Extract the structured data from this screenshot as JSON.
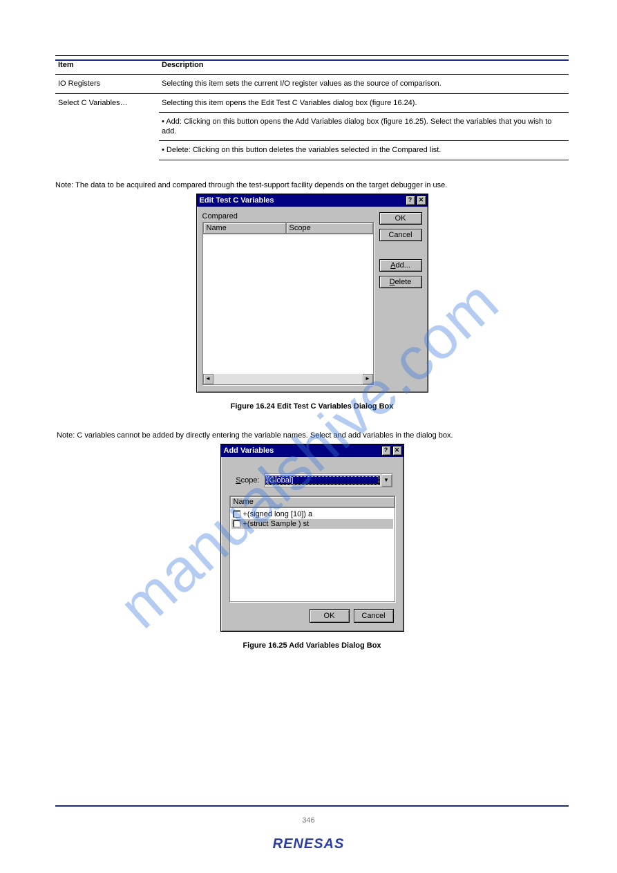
{
  "watermark": "manualshive.com",
  "brand": "RENESAS",
  "page_number": "346",
  "table": {
    "header_left": "Item",
    "header_right": "Description",
    "rows": [
      {
        "item": "IO Registers",
        "desc": "Selecting this item sets the current I/O register values as the source of comparison."
      },
      {
        "item": "Select C Variables…",
        "desc_main": "Selecting this item opens the Edit Test C Variables dialog box (figure 16.24).",
        "sub": [
          "• Add: Clicking on this button opens the Add Variables dialog box (figure 16.25). Select the variables that you wish to add.",
          "• Delete: Clicking on this button deletes the variables selected in the Compared list."
        ]
      }
    ]
  },
  "notes": {
    "n1": "Note: The data to be acquired and compared through the test-support facility depends on the target debugger in use.",
    "n2": "Note: C variables cannot be added by directly entering the variable names. Select and add variables in the dialog box."
  },
  "dialog1": {
    "title": "Edit Test C Variables",
    "compared_label": "Compared",
    "cols": {
      "name": "Name",
      "scope": "Scope"
    },
    "buttons": {
      "ok": "OK",
      "cancel": "Cancel",
      "add": "Add...",
      "delete": "Delete"
    },
    "hotkey_add": "A",
    "hotkey_delete": "D"
  },
  "caption1": "Figure 16.24    Edit Test C Variables Dialog Box",
  "dialog2": {
    "title": "Add Variables",
    "scope_label": "Scope:",
    "scope_value": "[Global]",
    "col_name": "Name",
    "items": [
      "+(signed long [10]) a",
      "+(struct Sample ) st"
    ],
    "buttons": {
      "ok": "OK",
      "cancel": "Cancel"
    },
    "hotkey_scope": "S"
  },
  "caption2": "Figure 16.25    Add Variables Dialog Box"
}
